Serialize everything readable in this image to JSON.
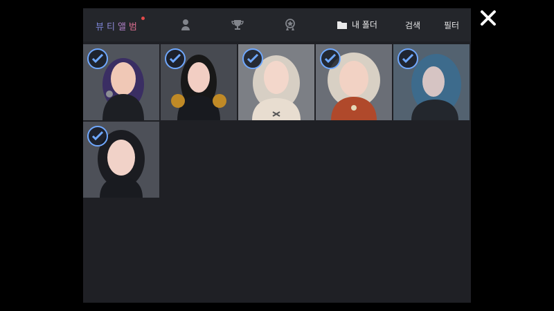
{
  "title": [
    "뷰",
    "티",
    "앨",
    "범"
  ],
  "header": {
    "folder_label": "내 폴더",
    "search_label": "검색",
    "filter_label": "필터"
  },
  "photos": [
    {
      "hair": "#3a2e63",
      "skin": "#f0c8b6",
      "outfit": "#1d1f24",
      "bg": "#50545c"
    },
    {
      "hair": "#181818",
      "skin": "#f2cec3",
      "outfit": "#181a1f",
      "bg": "#474a51"
    },
    {
      "hair": "#d7cfc4",
      "skin": "#f3d7cb",
      "outfit": "#e8ddd0",
      "bg": "#7c7f85"
    },
    {
      "hair": "#d8d0c4",
      "skin": "#f2d2c4",
      "outfit": "#b0492b",
      "bg": "#6a6e76"
    },
    {
      "hair": "#3d6b8c",
      "skin": "#d6c4c3",
      "outfit": "#23272d",
      "bg": "#536270"
    },
    {
      "hair": "#1b1c21",
      "skin": "#f1d2c8",
      "outfit": "#191b20",
      "bg": "#4d5058"
    }
  ]
}
